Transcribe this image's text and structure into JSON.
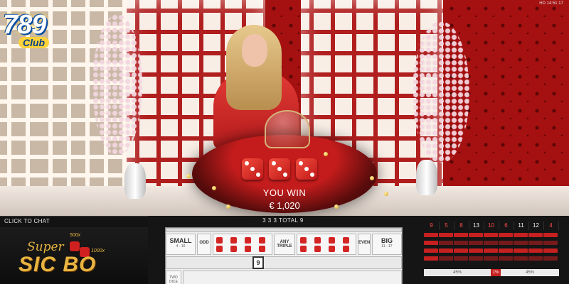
{
  "brand": {
    "logo_digits": "789",
    "logo_word": "Club"
  },
  "hud": {
    "top_right": "HD  14:51:17"
  },
  "dealer_scene": {
    "result_dice": [
      3,
      3,
      3
    ]
  },
  "win_overlay": {
    "title": "YOU WIN",
    "amount": "€ 1,020"
  },
  "chat": {
    "label": "CLICK TO CHAT"
  },
  "game_logo": {
    "line1": "Super",
    "line2": "SIC BO",
    "multiplier_a": "500x",
    "multiplier_b": "1000x"
  },
  "round_result": {
    "text": "3 3 3   TOTAL 9"
  },
  "board": {
    "small_label": "SMALL",
    "small_range": "4 - 10",
    "odd_label": "ODD",
    "any_triple_label": "ANY TRIPLE",
    "even_label": "EVEN",
    "big_label": "BIG",
    "big_range": "11 - 17",
    "totals_row_label": "TWO DICE",
    "highlight_total": "9"
  },
  "stats": {
    "totals_history": [
      "9",
      "5",
      "8",
      "13",
      "10",
      "6",
      "11",
      "12",
      "4"
    ],
    "split": {
      "small_pct": "45%",
      "triple_pct": "1%",
      "big_pct": "45%"
    }
  }
}
